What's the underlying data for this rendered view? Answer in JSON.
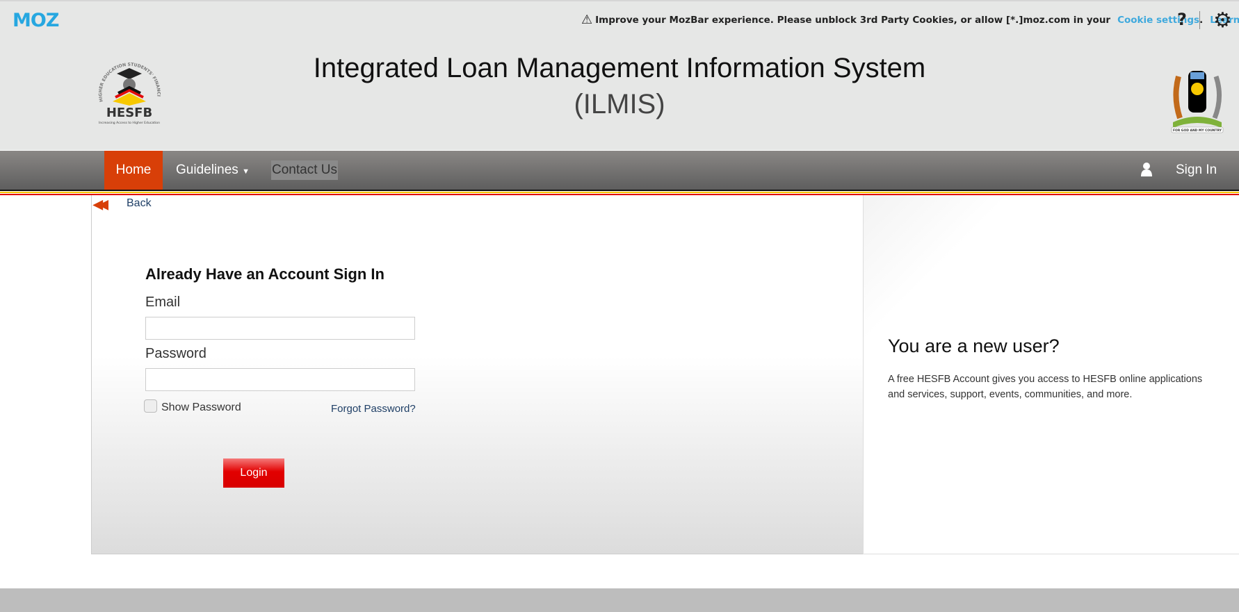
{
  "mozbar": {
    "logo": "MOZ",
    "message": "Improve your MozBar experience. Please unblock 3rd Party Cookies, or allow [*.]moz.com in your",
    "cookie_link": "Cookie settings",
    "period": ".",
    "learn_more": "Learn more",
    "help": "?",
    "icons": [
      "warning-icon",
      "gear-icon"
    ]
  },
  "header": {
    "title": "Integrated Loan Management Information System",
    "subtitle": "(ILMIS)",
    "left_logo_text": "HESFB",
    "left_logo_ring": "HIGHER EDUCATION STUDENTS' FINANCING BOARD",
    "left_logo_tagline": "Increasing Access to Higher Education",
    "right_logo_motto": "FOR GOD AND MY COUNTRY"
  },
  "nav": {
    "home": "Home",
    "guidelines": "Guidelines",
    "contact": "Contact Us",
    "signin": "Sign In",
    "active_color": "#d83f08"
  },
  "back": "Back",
  "login": {
    "heading": "Already Have an Account Sign In",
    "email_label": "Email",
    "email_value": "",
    "password_label": "Password",
    "password_value": "",
    "show_password": "Show Password",
    "show_password_checked": false,
    "forgot": "Forgot Password?",
    "button": "Login",
    "button_color": "#e20000"
  },
  "new_user": {
    "heading": "You are a new user?",
    "text": "A free HESFB Account gives you access to HESFB online applications and services, support, events, communities, and more."
  }
}
